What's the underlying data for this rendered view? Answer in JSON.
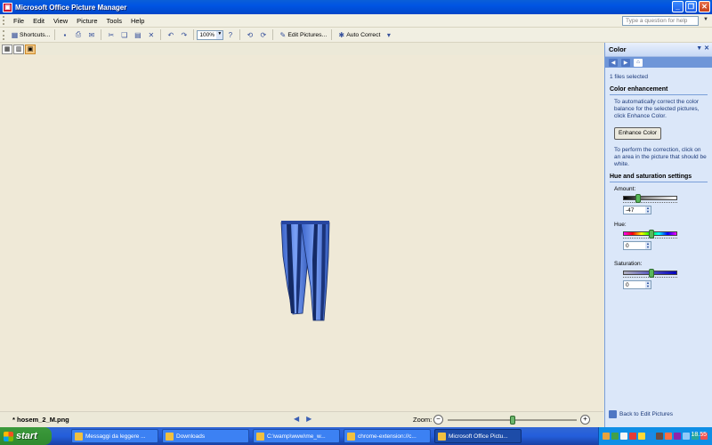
{
  "window": {
    "title": "Microsoft Office Picture Manager",
    "app_icon": "picture-manager-icon",
    "controls": [
      "_",
      "❐",
      "✕"
    ]
  },
  "menubar": {
    "items": [
      "File",
      "Edit",
      "View",
      "Picture",
      "Tools",
      "Help"
    ],
    "help_placeholder": "Type a question for help"
  },
  "toolbar": {
    "shortcuts_label": "Shortcuts...",
    "zoom_value": "100%",
    "edit_pictures_label": "Edit Pictures...",
    "auto_correct_label": "Auto Correct"
  },
  "status": {
    "filename": "* hosem_2_M.png",
    "zoom_label": "Zoom:",
    "zoom_fraction": 0.5
  },
  "taskpane": {
    "title": "Color",
    "files_selected": "1 files selected",
    "color_enhancement_title": "Color enhancement",
    "enhance_help": "To automatically correct the color balance for the selected pictures, click Enhance Color.",
    "enhance_button": "Enhance Color",
    "click_help": "To perform the correction, click on an area in the picture that should be white.",
    "hue_sat_title": "Hue and saturation settings",
    "amount_label": "Amount:",
    "amount_value": "-47",
    "amount_fraction": 0.27,
    "hue_label": "Hue:",
    "hue_value": "0",
    "hue_fraction": 0.5,
    "saturation_label": "Saturation:",
    "saturation_value": "0",
    "saturation_fraction": 0.5,
    "back_link": "Back to Edit Pictures"
  },
  "taskbar": {
    "start_label": "start",
    "tasks": [
      "Messaggi da leggere ...",
      "Downloads",
      "C:\\wamp\\www\\me_w...",
      "chrome-extension://c...",
      "Microsoft Office Pictu..."
    ],
    "active_task_index": 4,
    "clock": "18.55",
    "tray_colors": [
      "#e8a33c",
      "#43a047",
      "#f5f5f5",
      "#e53935",
      "#fdd835",
      "#1e88e5",
      "#6d4c41",
      "#ff7043",
      "#8e24aa",
      "#90caf9",
      "#26a69a",
      "#ef5350"
    ]
  }
}
